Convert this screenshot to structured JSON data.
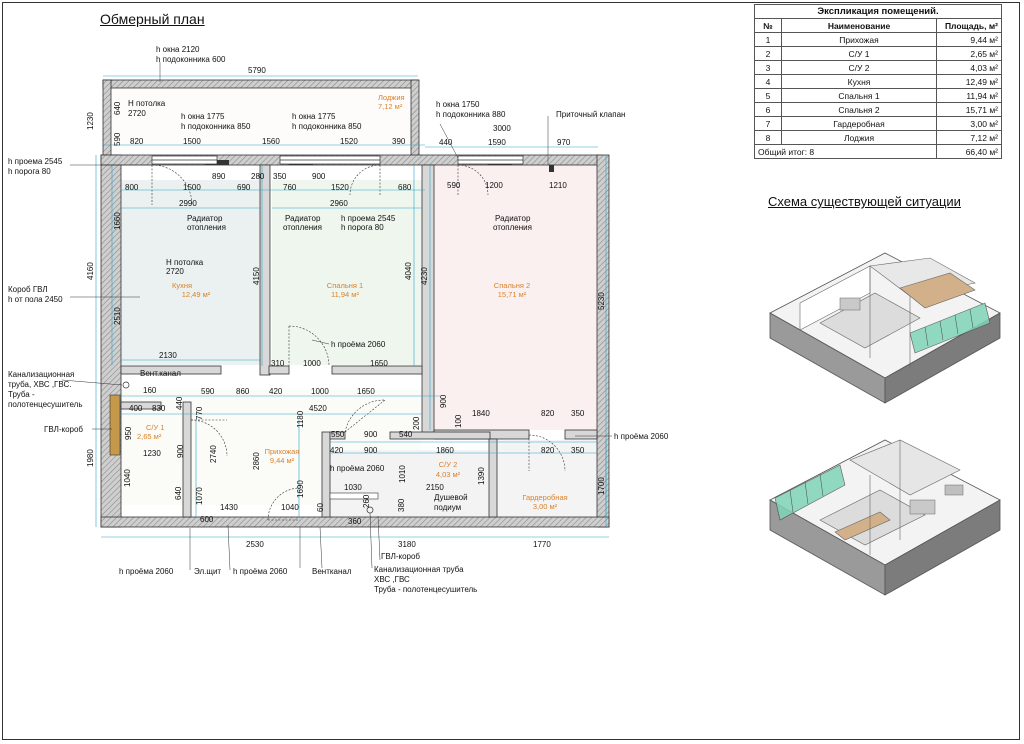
{
  "titles": {
    "plan": "Обмерный план",
    "scheme": "Схема существующей ситуации"
  },
  "explication": {
    "title": "Экспликация помещений.",
    "headers": [
      "№",
      "Наименование",
      "Площадь, м²"
    ],
    "rows": [
      [
        "1",
        "Прихожая",
        "9,44 м²"
      ],
      [
        "2",
        "С/У 1",
        "2,65 м²"
      ],
      [
        "3",
        "С/У 2",
        "4,03 м²"
      ],
      [
        "4",
        "Кухня",
        "12,49 м²"
      ],
      [
        "5",
        "Спальня 1",
        "11,94 м²"
      ],
      [
        "6",
        "Спальня 2",
        "15,71 м²"
      ],
      [
        "7",
        "Гардеробная",
        "3,00 м²"
      ],
      [
        "8",
        "Лоджия",
        "7,12 м²"
      ]
    ],
    "total_label": "Общий итог: 8",
    "total_value": "66,40 м²"
  },
  "rooms": {
    "loggia": [
      "Лоджия",
      "7,12 м²"
    ],
    "kitchen": [
      "Кухня",
      "12,49 м²"
    ],
    "bed1": [
      "Спальня 1",
      "11,94 м²"
    ],
    "bed2": [
      "Спальня 2",
      "15,71 м²"
    ],
    "hall": [
      "Прихожая",
      "9,44 м²"
    ],
    "wc1": [
      "С/У 1",
      "2,65 м²"
    ],
    "wc2": [
      "С/У 2",
      "4,03 м²"
    ],
    "wardrobe": [
      "Гардеробная",
      "3,00 м²"
    ]
  },
  "notes": {
    "win1": [
      "h окна 2120",
      "h подоконника 600"
    ],
    "ceil1": [
      "Н потолка",
      "2720"
    ],
    "win2": [
      "h окна 1775",
      "h подоконника 850"
    ],
    "win3": [
      "h окна 1775",
      "h подоконника 850"
    ],
    "win4": [
      "h окна 1750",
      "h подоконника 880"
    ],
    "valve": "Приточный клапан",
    "opening_left": [
      "h проема 2545",
      "h порога 80"
    ],
    "rad1": [
      "Радиатор",
      "отопления"
    ],
    "rad2": [
      "Радиатор",
      "отопления"
    ],
    "rad3": [
      "Радиатор",
      "отопления"
    ],
    "opening_mid": [
      "h проема 2545",
      "h порога 80"
    ],
    "ceil2": [
      "Н потолка",
      "2720"
    ],
    "box": [
      "Короб ГВЛ",
      "h от пола 2450"
    ],
    "door_bed1": "h проёма 2060",
    "sewer_left": [
      "Канализационная",
      "труба, ХВС ,ГВС.",
      "Труба -",
      "полотенцесушитель"
    ],
    "vent1": "Вент.канал",
    "gvl_left": "ГВЛ-короб",
    "door_right": "h проёма 2060",
    "door_wc2": "h проёма 2060",
    "shower": [
      "Душевой",
      "подиум"
    ],
    "door_b1": "h проёма 2060",
    "panel": "Эл.щит",
    "door_b2": "h проёма 2060",
    "vent2": "Вентканал",
    "gvl_bottom": "ГВЛ-короб",
    "sewer_bottom": [
      "Канализационная труба",
      "ХВС ,ГВС",
      "Труба - полотенцесушитель"
    ]
  },
  "dims": {
    "top_overall": "5790",
    "loggia_left": "640",
    "left_1230": "1230",
    "top_820": "820",
    "top_1500": "1500",
    "top_1560": "1560",
    "top_1520": "1520",
    "top_390": "390",
    "top_590": "590",
    "top_3000": "3000",
    "top_440": "440",
    "top_1590": "1590",
    "top_970": "970",
    "r2_800": "800",
    "r2_1500": "1500",
    "r2_890": "890",
    "r2_690": "690",
    "r2_280": "280",
    "r2_350": "350",
    "r2_760": "760",
    "r2_900": "900",
    "r2_1520": "1520",
    "r2_680": "680",
    "r2_590": "590",
    "r2_1200": "1200",
    "r2_1210": "1210",
    "k_2990": "2990",
    "b1_2960": "2960",
    "left_4160": "4160",
    "k_1660": "1660",
    "k_2510": "2510",
    "k_4150": "4150",
    "b1_4040": "4040",
    "b2_4230": "4230",
    "right_5230": "5230",
    "k_2130": "2130",
    "d_310": "310",
    "d_1000": "1000",
    "d_1650": "1650",
    "c_160": "160",
    "c_590": "590",
    "c_860": "860",
    "c_420": "420",
    "c_1000": "1000",
    "c_1650": "1650",
    "c_400": "400",
    "c_830": "830",
    "c_440": "440",
    "c_770": "770",
    "c_4520": "4520",
    "c_1180": "1180",
    "c_900v": "900",
    "c_200": "200",
    "c_100": "100",
    "c_1840": "1840",
    "c_820": "820",
    "c_350": "350",
    "h_550": "550",
    "h_900": "900",
    "h_540": "540",
    "h_420": "420",
    "h_900b": "900",
    "h_1860": "1860",
    "h_820": "820",
    "h_350": "350",
    "w_950": "950",
    "w_900": "900",
    "w_2740": "2740",
    "w_1980": "1980",
    "w_1230": "1230",
    "w_2860": "2860",
    "w_1040": "1040",
    "w_640": "640",
    "w_1070": "1070",
    "s_1010": "1010",
    "s_1390": "1390",
    "s_1030": "1030",
    "s_2150": "2150",
    "s_260": "260",
    "s_380": "380",
    "s_360": "360",
    "s_60": "60",
    "s_1690": "1690",
    "s_1040": "1040",
    "s_1430": "1430",
    "s_600": "600",
    "g_1700": "1700",
    "bot_2530": "2530",
    "bot_3180": "3180",
    "bot_1770": "1770"
  }
}
